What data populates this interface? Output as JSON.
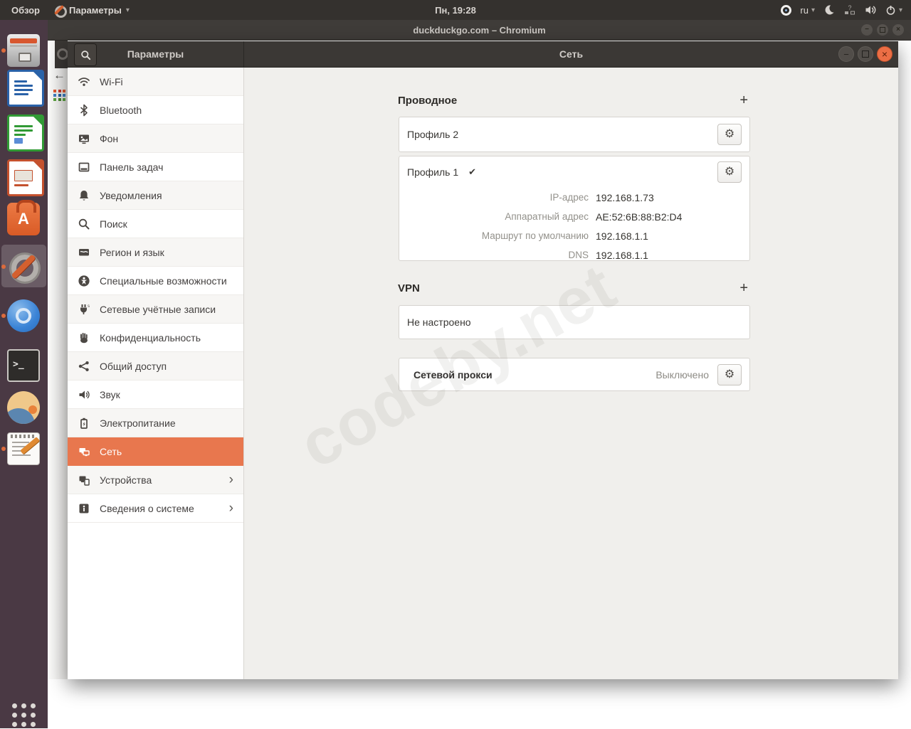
{
  "topbar": {
    "activities_label": "Обзор",
    "app_menu_label": "Параметры",
    "clock": "Пн, 19:28",
    "language": "ru"
  },
  "chromium": {
    "title": "duckduckgo.com – Chromium"
  },
  "window": {
    "sidebar_title": "Параметры",
    "page_title": "Сеть"
  },
  "sidebar": {
    "items": [
      {
        "label": "Wi-Fi",
        "icon": "wifi-icon"
      },
      {
        "label": "Bluetooth",
        "icon": "bluetooth-icon"
      },
      {
        "label": "Фон",
        "icon": "background-icon"
      },
      {
        "label": "Панель задач",
        "icon": "dock-panel-icon"
      },
      {
        "label": "Уведомления",
        "icon": "notifications-icon"
      },
      {
        "label": "Поиск",
        "icon": "search-icon"
      },
      {
        "label": "Регион и язык",
        "icon": "region-language-icon"
      },
      {
        "label": "Специальные возможности",
        "icon": "accessibility-icon"
      },
      {
        "label": "Сетевые учётные записи",
        "icon": "online-accounts-icon"
      },
      {
        "label": "Конфиденциальность",
        "icon": "privacy-icon"
      },
      {
        "label": "Общий доступ",
        "icon": "sharing-icon"
      },
      {
        "label": "Звук",
        "icon": "sound-icon"
      },
      {
        "label": "Электропитание",
        "icon": "power-icon"
      },
      {
        "label": "Сеть",
        "icon": "network-icon",
        "selected": true
      },
      {
        "label": "Устройства",
        "icon": "devices-icon",
        "chevron": true
      },
      {
        "label": "Сведения о системе",
        "icon": "about-icon",
        "chevron": true
      }
    ]
  },
  "network_page": {
    "wired": {
      "title": "Проводное",
      "profiles": [
        {
          "name": "Профиль 2"
        },
        {
          "name": "Профиль 1",
          "active": true
        }
      ],
      "details": [
        {
          "label": "IP-адрес",
          "value": "192.168.1.73"
        },
        {
          "label": "Аппаратный адрес",
          "value": "AE:52:6B:88:B2:D4"
        },
        {
          "label": "Маршрут по умолчанию",
          "value": "192.168.1.1"
        },
        {
          "label": "DNS",
          "value": "192.168.1.1"
        }
      ]
    },
    "vpn": {
      "title": "VPN",
      "status": "Не настроено"
    },
    "proxy": {
      "title": "Сетевой прокси",
      "status": "Выключено"
    }
  },
  "glyphs": {
    "plus": "+",
    "gear": "⚙",
    "check": "✔",
    "chevron_right": "›",
    "caret_down": "▾",
    "back_arrow": "←",
    "minimize": "−",
    "close": "×",
    "question": "?",
    "terminal_prompt": ">_",
    "software_a": "A"
  },
  "watermark": {
    "text": "codeby.net"
  },
  "colors": {
    "accent_orange": "#e8774e",
    "topbar_bg": "#34312e",
    "header_bg": "#3b3835",
    "content_bg": "#f0efec",
    "dock_bg": "#4a3944"
  }
}
